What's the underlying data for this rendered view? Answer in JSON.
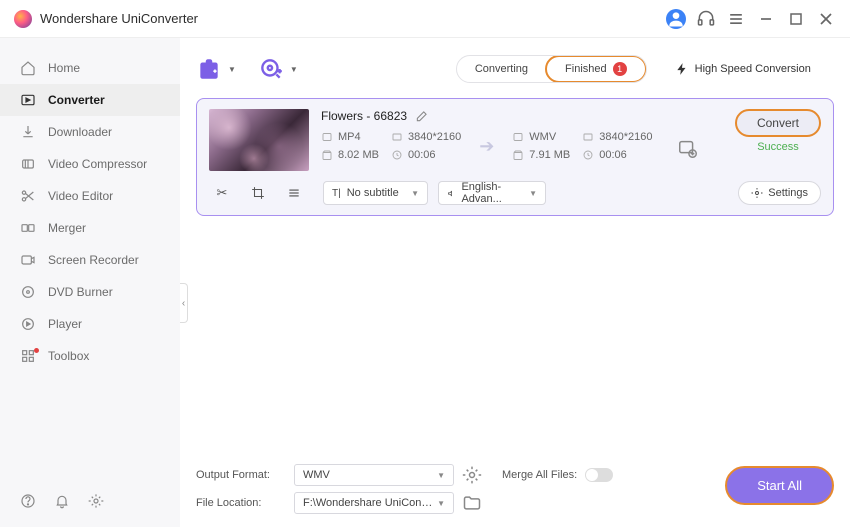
{
  "app": {
    "title": "Wondershare UniConverter"
  },
  "titlebar": {
    "user": "👤"
  },
  "sidebar": {
    "items": [
      {
        "label": "Home"
      },
      {
        "label": "Converter"
      },
      {
        "label": "Downloader"
      },
      {
        "label": "Video Compressor"
      },
      {
        "label": "Video Editor"
      },
      {
        "label": "Merger"
      },
      {
        "label": "Screen Recorder"
      },
      {
        "label": "DVD Burner"
      },
      {
        "label": "Player"
      },
      {
        "label": "Toolbox"
      }
    ]
  },
  "tabs": {
    "converting": "Converting",
    "finished": "Finished",
    "finished_count": "1"
  },
  "hsc": "High Speed Conversion",
  "file": {
    "name": "Flowers - 66823",
    "src": {
      "format": "MP4",
      "res": "3840*2160",
      "size": "8.02 MB",
      "dur": "00:06"
    },
    "dst": {
      "format": "WMV",
      "res": "3840*2160",
      "size": "7.91 MB",
      "dur": "00:06"
    },
    "convert": "Convert",
    "status": "Success",
    "subtitle": "No subtitle",
    "audio": "English-Advan...",
    "settings": "Settings"
  },
  "footer": {
    "output_label": "Output Format:",
    "output_value": "WMV",
    "loc_label": "File Location:",
    "loc_value": "F:\\Wondershare UniConverter",
    "merge": "Merge All Files:",
    "start": "Start All"
  }
}
